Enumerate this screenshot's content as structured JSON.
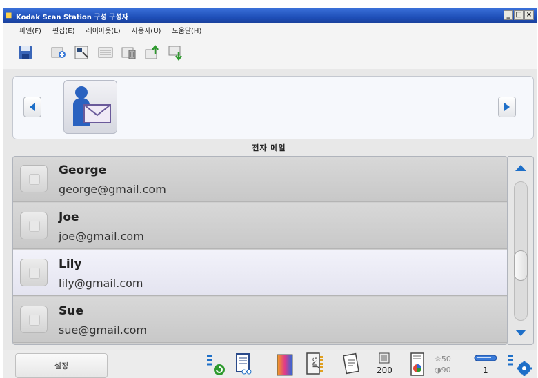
{
  "window": {
    "title": "Kodak Scan Station 구성 구성자",
    "icon": "app-icon"
  },
  "menu": [
    {
      "label": "파일(F)"
    },
    {
      "label": "편집(E)"
    },
    {
      "label": "레이아웃(L)"
    },
    {
      "label": "사용자(U)"
    },
    {
      "label": "도움말(H)"
    }
  ],
  "toolbar": {
    "icons": [
      "save-icon",
      "add-icon",
      "properties-icon",
      "list-icon",
      "delete-icon",
      "export-icon",
      "import-icon"
    ]
  },
  "destination": {
    "icon": "email-recipient-icon",
    "section_title": "전자 메일"
  },
  "contacts": [
    {
      "name": "George",
      "email": "george@gmail.com",
      "selected": false
    },
    {
      "name": "Joe",
      "email": "joe@gmail.com",
      "selected": false
    },
    {
      "name": "Lily",
      "email": "lily@gmail.com",
      "selected": true
    },
    {
      "name": "Sue",
      "email": "sue@gmail.com",
      "selected": false
    }
  ],
  "statusbar": {
    "settings_label": "설정",
    "resolution": "200",
    "brightness_label": "50",
    "contrast_label": "90",
    "copies": "1"
  },
  "colors": {
    "accent": "#1e6fc8",
    "title_bar": "#1e4fb8",
    "selected_row": "#ececf6"
  }
}
